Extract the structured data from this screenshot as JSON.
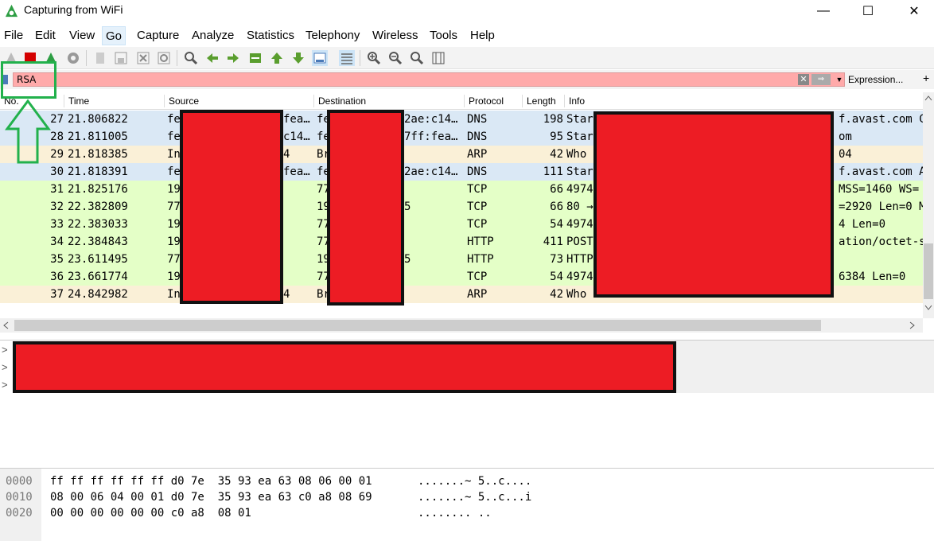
{
  "window": {
    "title": "Capturing from WiFi",
    "minimize": "—",
    "maximize": "☐",
    "close": "✕"
  },
  "menu": [
    "File",
    "Edit",
    "View",
    "Go",
    "Capture",
    "Analyze",
    "Statistics",
    "Telephony",
    "Wireless",
    "Tools",
    "Help"
  ],
  "filter": {
    "value": "RSA",
    "clear": "✕",
    "apply": "⇒",
    "dropdown": "▼",
    "expression": "Expression...",
    "add": "+"
  },
  "columns": [
    "No.",
    "Time",
    "Source",
    "Destination",
    "Protocol",
    "Length",
    "Info"
  ],
  "packets": [
    {
      "no": "27",
      "time": "21.806822",
      "source": "fe",
      "source2": "fea…",
      "dest": "fe",
      "dest2": "2ae:c14…",
      "proto": "DNS",
      "len": "198",
      "info": "Star",
      "info2": "f.avast.com C",
      "type": "dns"
    },
    {
      "no": "28",
      "time": "21.811005",
      "source": "fe",
      "source2": "c14…",
      "dest": "fe",
      "dest2": "7ff:fea…",
      "proto": "DNS",
      "len": "95",
      "info": "Star",
      "info2": "om",
      "type": "dns"
    },
    {
      "no": "29",
      "time": "21.818385",
      "source": "In",
      "source2": "4",
      "dest": "Br",
      "dest2": "",
      "proto": "ARP",
      "len": "42",
      "info": "Who",
      "info2": "04",
      "type": "arp"
    },
    {
      "no": "30",
      "time": "21.818391",
      "source": "fe",
      "source2": "fea…",
      "dest": "fe",
      "dest2": "2ae:c14…",
      "proto": "DNS",
      "len": "111",
      "info": "Star",
      "info2": "f.avast.com A",
      "type": "dns"
    },
    {
      "no": "31",
      "time": "21.825176",
      "source": "19",
      "source2": "",
      "dest": "77",
      "dest2": "",
      "proto": "TCP",
      "len": "66",
      "info": "4974",
      "info2": "MSS=1460 WS=",
      "type": "tcp"
    },
    {
      "no": "32",
      "time": "22.382809",
      "source": "77",
      "source2": "",
      "dest": "19",
      "dest2": "5",
      "proto": "TCP",
      "len": "66",
      "info": "80 →",
      "info2": "=2920 Len=0 M",
      "type": "tcp"
    },
    {
      "no": "33",
      "time": "22.383033",
      "source": "19",
      "source2": "",
      "dest": "77",
      "dest2": "",
      "proto": "TCP",
      "len": "54",
      "info": "4974",
      "info2": "4 Len=0",
      "type": "tcp"
    },
    {
      "no": "34",
      "time": "22.384843",
      "source": "19",
      "source2": "",
      "dest": "77",
      "dest2": "",
      "proto": "HTTP",
      "len": "411",
      "info": "POST",
      "info2": "ation/octet-s",
      "type": "tcp"
    },
    {
      "no": "35",
      "time": "23.611495",
      "source": "77",
      "source2": "",
      "dest": "19",
      "dest2": "5",
      "proto": "HTTP",
      "len": "73",
      "info": "HTTP",
      "info2": "",
      "type": "tcp"
    },
    {
      "no": "36",
      "time": "23.661774",
      "source": "19",
      "source2": "",
      "dest": "77",
      "dest2": "",
      "proto": "TCP",
      "len": "54",
      "info": "4974",
      "info2": "6384 Len=0",
      "type": "tcp"
    },
    {
      "no": "37",
      "time": "24.842982",
      "source": "In",
      "source2": "4",
      "dest": "Br",
      "dest2": "",
      "proto": "ARP",
      "len": "42",
      "info": "Who has 192.168.8.1? Tell 192.168.8.104",
      "info2": "",
      "type": "arp"
    }
  ],
  "details": [
    ">",
    ">",
    ">"
  ],
  "bytes": [
    {
      "offset": "0000",
      "hex": "ff ff ff ff ff ff d0 7e  35 93 ea 63 08 06 00 01",
      "ascii": ".......~ 5..c...."
    },
    {
      "offset": "0010",
      "hex": "08 00 06 04 00 01 d0 7e  35 93 ea 63 c0 a8 08 69",
      "ascii": ".......~ 5..c...i"
    },
    {
      "offset": "0020",
      "hex": "00 00 00 00 00 00 c0 a8  08 01",
      "ascii": "........ .."
    }
  ],
  "colors": {
    "dns": "#dae8f5",
    "arp": "#faf0d7",
    "tcp": "#e4ffc7",
    "filter_bad": "#ffaaaa",
    "redaction": "#ed1c24",
    "annotation": "#22b14c"
  }
}
